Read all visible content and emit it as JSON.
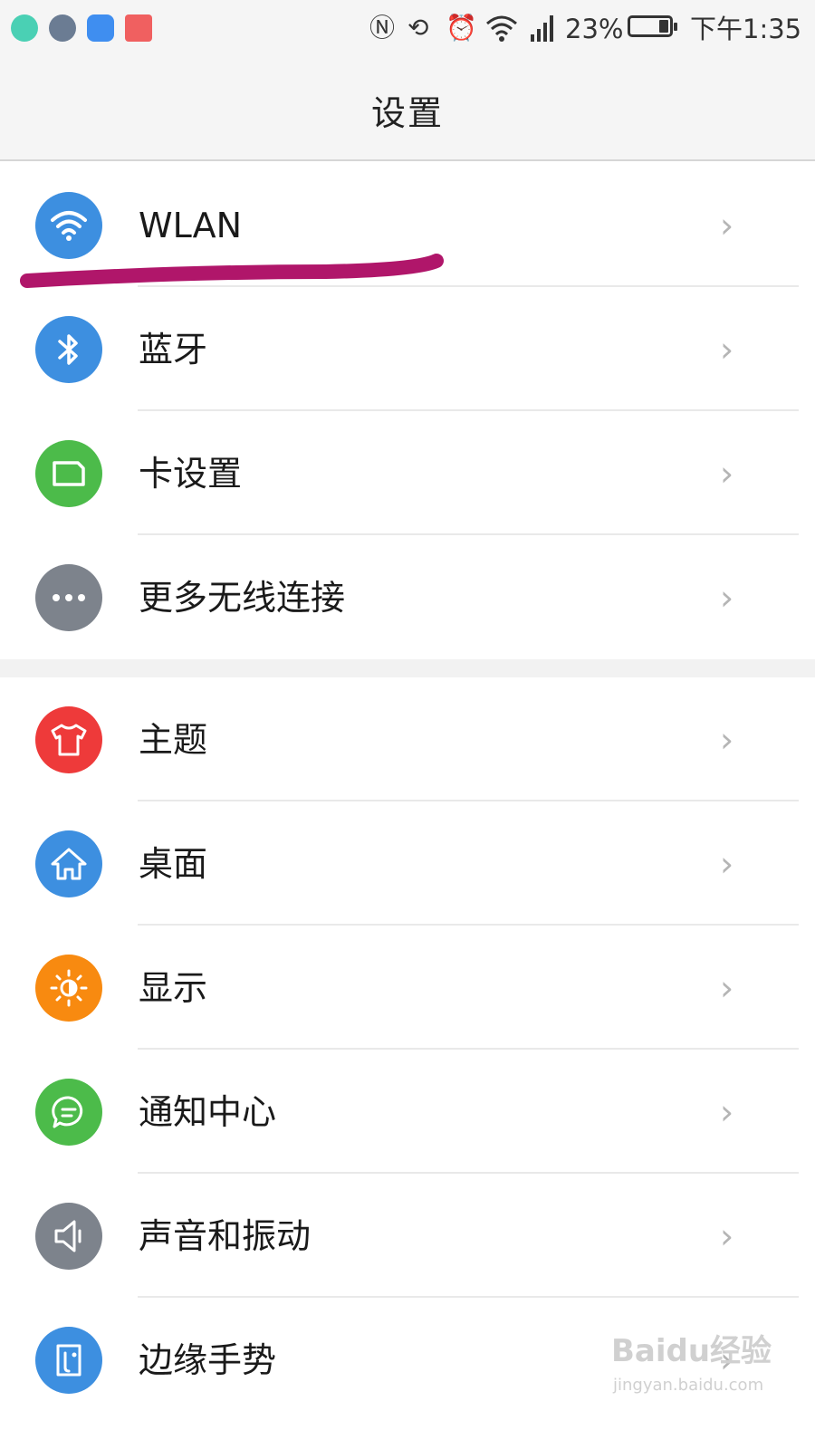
{
  "status_bar": {
    "battery_percent": "23%",
    "time": "下午1:35"
  },
  "header": {
    "title": "设置"
  },
  "group1": [
    {
      "label": "WLAN",
      "icon": "wifi-icon",
      "color": "#3d8fe0"
    },
    {
      "label": "蓝牙",
      "icon": "bluetooth-icon",
      "color": "#3d8fe0"
    },
    {
      "label": "卡设置",
      "icon": "sim-card-icon",
      "color": "#4cbb4a"
    },
    {
      "label": "更多无线连接",
      "icon": "more-icon",
      "color": "#7d838c"
    }
  ],
  "group2": [
    {
      "label": "主题",
      "icon": "tshirt-icon",
      "color": "#ee3a3a"
    },
    {
      "label": "桌面",
      "icon": "home-icon",
      "color": "#3d8fe0"
    },
    {
      "label": "显示",
      "icon": "brightness-icon",
      "color": "#f88a10"
    },
    {
      "label": "通知中心",
      "icon": "message-icon",
      "color": "#4cbb4a"
    },
    {
      "label": "声音和振动",
      "icon": "speaker-icon",
      "color": "#7d838c"
    },
    {
      "label": "边缘手势",
      "icon": "edge-gesture-icon",
      "color": "#3d8fe0"
    }
  ],
  "chevron": "›",
  "watermark": {
    "main": "Baidu经验",
    "sub": "jingyan.baidu.com"
  },
  "accent_scribble_color": "#b0166a"
}
